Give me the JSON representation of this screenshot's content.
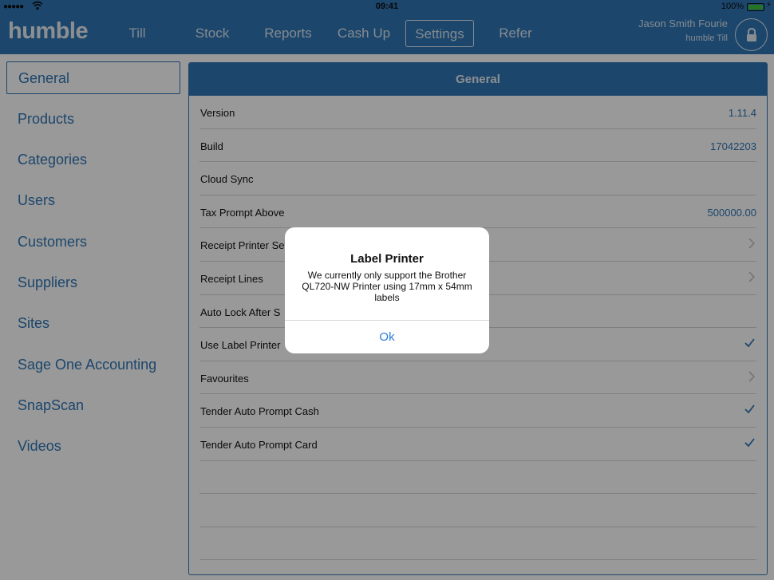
{
  "status": {
    "signal": "●●●●●",
    "time": "09:41",
    "battery": "100%"
  },
  "brand": "humble",
  "nav": {
    "tabs": [
      {
        "label": "Till"
      },
      {
        "label": "Stock"
      },
      {
        "label": "Reports"
      },
      {
        "label": "Cash Up"
      },
      {
        "label": "Settings"
      },
      {
        "label": "Refer"
      }
    ],
    "active_tab": "Settings",
    "user_name": "Jason Smith Fourie",
    "user_sub": "humble Till"
  },
  "sidebar": {
    "items": [
      {
        "label": "General"
      },
      {
        "label": "Products"
      },
      {
        "label": "Categories"
      },
      {
        "label": "Users"
      },
      {
        "label": "Customers"
      },
      {
        "label": "Suppliers"
      },
      {
        "label": "Sites"
      },
      {
        "label": "Sage One Accounting"
      },
      {
        "label": "SnapScan"
      },
      {
        "label": "Videos"
      }
    ],
    "active_item": "General"
  },
  "panel": {
    "title": "General",
    "rows": [
      {
        "label": "Version",
        "value": "1.11.4"
      },
      {
        "label": "Build",
        "value": "17042203"
      },
      {
        "label": "Cloud Sync",
        "value": ""
      },
      {
        "label": "Tax Prompt Above",
        "value": "500000.00"
      },
      {
        "label": "Receipt Printer Se",
        "value": ""
      },
      {
        "label": "Receipt Lines",
        "value": ""
      },
      {
        "label": "Auto Lock After S",
        "value": ""
      },
      {
        "label": "Use Label Printer",
        "value": ""
      },
      {
        "label": "Favourites",
        "value": ""
      },
      {
        "label": "Tender Auto Prompt Cash",
        "value": ""
      },
      {
        "label": "Tender Auto Prompt Card",
        "value": ""
      }
    ]
  },
  "alert": {
    "title": "Label Printer",
    "message": "We currently only support the Brother QL720-NW Printer using 17mm x 54mm labels",
    "ok_label": "Ok"
  },
  "colors": {
    "accent": "#2f75b5",
    "alert_button": "#2b7cd6"
  }
}
